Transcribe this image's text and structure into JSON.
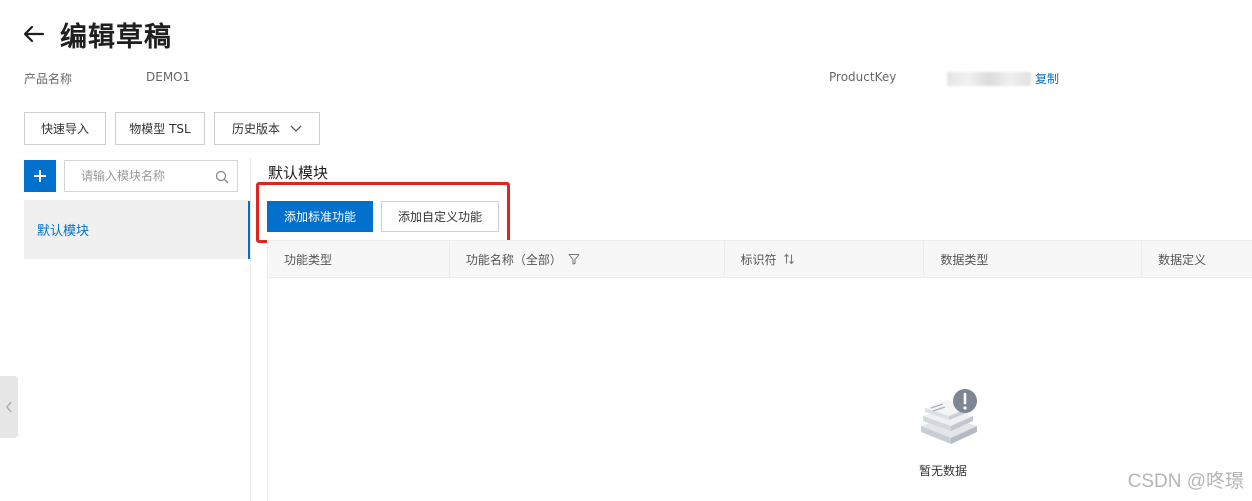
{
  "header": {
    "title": "编辑草稿"
  },
  "meta": {
    "product_name_label": "产品名称",
    "product_name_value": "DEMO1",
    "product_key_label": "ProductKey",
    "copy_label": "复制"
  },
  "toolbar": {
    "import_label": "快速导入",
    "tsl_label": "物模型 TSL",
    "history_label": "历史版本"
  },
  "sidebar": {
    "add_label": "+",
    "search_placeholder": "请输入模块名称",
    "items": [
      {
        "label": "默认模块",
        "selected": true
      }
    ]
  },
  "main": {
    "section_title": "默认模块",
    "add_standard_label": "添加标准功能",
    "add_custom_label": "添加自定义功能",
    "table": {
      "columns": [
        "功能类型",
        "功能名称（全部）",
        "标识符",
        "数据类型",
        "数据定义"
      ],
      "rows": []
    },
    "empty_text": "暂无数据"
  },
  "watermark": "CSDN @咚璟",
  "colors": {
    "primary": "#0070cc",
    "highlight_border": "#e0251f",
    "header_bg": "#f7f7f7",
    "selected_bg": "#f0f0f0"
  }
}
